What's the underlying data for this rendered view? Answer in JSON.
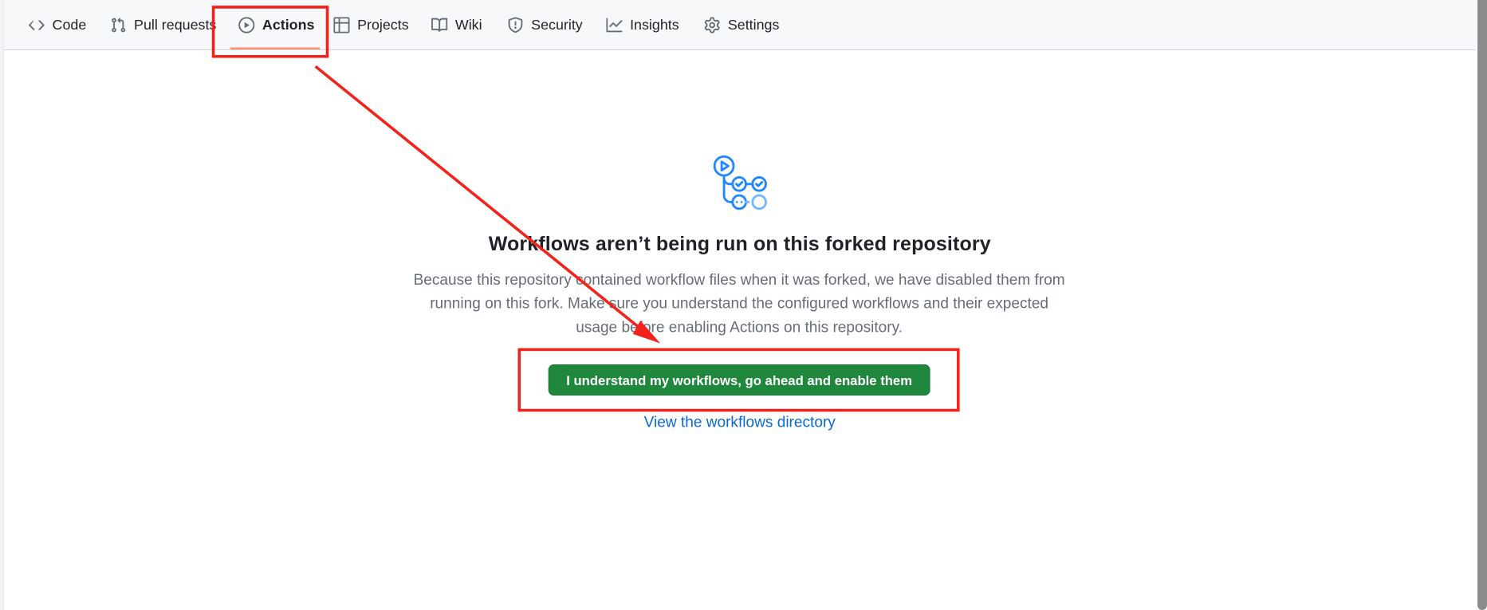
{
  "repo_nav": {
    "items": [
      {
        "label": "Code",
        "icon": "code-icon",
        "selected": false
      },
      {
        "label": "Pull requests",
        "icon": "git-pull-request-icon",
        "selected": false
      },
      {
        "label": "Actions",
        "icon": "play-icon",
        "selected": true
      },
      {
        "label": "Projects",
        "icon": "table-icon",
        "selected": false
      },
      {
        "label": "Wiki",
        "icon": "book-icon",
        "selected": false
      },
      {
        "label": "Security",
        "icon": "shield-icon",
        "selected": false
      },
      {
        "label": "Insights",
        "icon": "graph-icon",
        "selected": false
      },
      {
        "label": "Settings",
        "icon": "gear-icon",
        "selected": false
      }
    ]
  },
  "blankslate": {
    "icon": "actions-workflow-icon",
    "heading": "Workflows aren’t being run on this forked repository",
    "description_lines": [
      "Because this repository contained workflow files when it was forked, we have disabled them from",
      "running on this fork. Make sure you understand the configured workflows and their expected",
      "usage before enabling Actions on this repository."
    ],
    "enable_button_label": "I understand my workflows, go ahead and enable them",
    "directory_link_label": "View the workflows directory"
  },
  "colors": {
    "primary_button": "#1f883d",
    "link": "#0969da",
    "selected_tab_underline": "#fd8c73",
    "annotation": "#f5221b",
    "icon_blue": "#2188ff"
  },
  "annotations": {
    "highlight_targets": [
      "Actions tab",
      "enable workflows button"
    ],
    "arrow": "from Actions tab to enable workflows button"
  }
}
